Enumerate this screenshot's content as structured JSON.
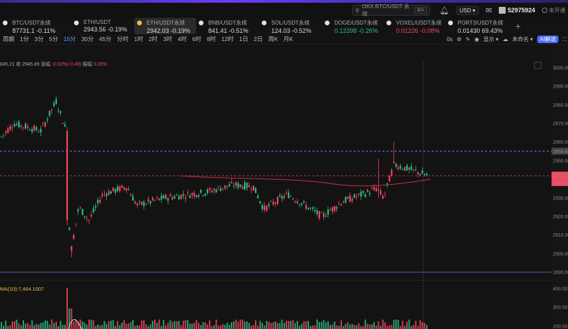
{
  "topbar": {
    "search_placeholder": "OKX BTC/USDT 永续",
    "search_kbd": "⌘K",
    "currency": "USD",
    "user_id": "52975924",
    "verify_status": "未开通"
  },
  "tickers": [
    {
      "name": "BTC/USDT永续",
      "price": "87731.1",
      "change": "-0.11%",
      "dir": "down"
    },
    {
      "name": "ETH/USDT",
      "price": "2943.56",
      "change": "-0.19%",
      "dir": "down"
    },
    {
      "name": "ETH/USDT永续",
      "price": "2942.03",
      "change": "-0.19%",
      "dir": "down",
      "active": true
    },
    {
      "name": "BNB/USDT永续",
      "price": "841.41",
      "change": "-0.51%",
      "dir": "down"
    },
    {
      "name": "SOL/USDT永续",
      "price": "124.03",
      "change": "-0.52%",
      "dir": "down"
    },
    {
      "name": "DOGE/USDT永续",
      "price": "0.12398",
      "change": "-0.26%",
      "dir": "green"
    },
    {
      "name": "VOXEL/USDT永续",
      "price": "0.01226",
      "change": "-0.08%",
      "dir": "red"
    },
    {
      "name": "PORT3/USDT永续",
      "price": "0.01430",
      "change": "69.43%",
      "dir": "down"
    }
  ],
  "toolbar": {
    "period_label": "周期",
    "periods": [
      "1分",
      "3分",
      "5分",
      "15分",
      "30分",
      "45分",
      "分时",
      "1时",
      "2时",
      "3时",
      "4时",
      "6时",
      "8时",
      "12时",
      "1日",
      "2日",
      "周K",
      "月K"
    ],
    "selected_period": "15分",
    "right_latency": "0s",
    "display_label": "显示",
    "layout_name": "未命名",
    "ai_label": "AI解读"
  },
  "info_line": {
    "prefix": "845.21",
    "close_label": "收",
    "close_value": "2945.89",
    "change_label": "涨幅",
    "change_value": "-0.02%(-0.49)",
    "amp_label": "振幅",
    "amp_value": "0.05%"
  },
  "ma_label": "MA(10):7,464.1007",
  "price_axis": {
    "labels": [
      "3000.00",
      "2990.00",
      "2980.00",
      "2970.00",
      "2960.00",
      "2950.00",
      "2940.00",
      "2930.00",
      "2920.00",
      "2910.00",
      "2900.00",
      "2890.00"
    ],
    "marker_upper": "2954.88",
    "marker_current": "2942.03",
    "marker_countdown": "04:32"
  },
  "volume_axis": {
    "labels": [
      "400.00",
      "300.00",
      "200.00",
      "100.00"
    ]
  },
  "colors": {
    "up": "#2ebd85",
    "down": "#f6465d",
    "accent": "#5aa0ff",
    "purple_line": "#9b6cff"
  }
}
